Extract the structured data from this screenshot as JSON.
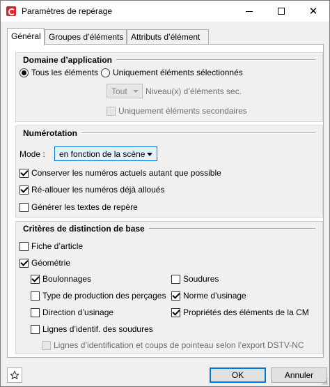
{
  "window": {
    "title": "Paramètres de repérage",
    "icon": "app-logo-icon",
    "controls": {
      "minimize": "minimize-icon",
      "maximize": "maximize-icon",
      "close": "✕"
    }
  },
  "tabs": [
    {
      "label": "Général",
      "active": true
    },
    {
      "label": "Groupes d’éléments",
      "active": false
    },
    {
      "label": "Attributs d’élément",
      "active": false
    }
  ],
  "domaine": {
    "title": "Domaine d’application",
    "radio_all": "Tous les éléments",
    "radio_selected": "Uniquement éléments sélectionnés",
    "level_combo": "Tout",
    "level_label": "Niveau(x) d’éléments sec.",
    "secondary_only": "Uniquement éléments secondaires"
  },
  "numerotation": {
    "title": "Numérotation",
    "mode_label": "Mode :",
    "mode_value": "en fonction de la scène",
    "keep_numbers": "Conserver les numéros actuels autant que possible",
    "reallocate": "Ré-allouer les numéros déjà alloués",
    "generate_texts": "Générer les textes de repère"
  },
  "criteres": {
    "title": "Critères de distinction de base",
    "fiche_article": "Fiche d’article",
    "geometrie": "Géométrie",
    "boulonnages": "Boulonnages",
    "soudures": "Soudures",
    "type_percages": "Type de production des perçages",
    "norme_usinage": "Norme d’usinage",
    "direction_usinage": "Direction d’usinage",
    "proprietes_cm": "Propriétés des éléments de la CM",
    "lignes_soudures": "Lignes d’identif. des soudures",
    "lignes_dstv": "Lignes d’identification et coups de pointeau selon l’export DSTV-NC"
  },
  "footer": {
    "favorite_icon": "star-icon",
    "ok": "OK",
    "cancel": "Annuler"
  },
  "colors": {
    "accent": "#0078d7",
    "dialog_bg": "#f0f0f0",
    "title_bar_bg": "#ffffff"
  }
}
